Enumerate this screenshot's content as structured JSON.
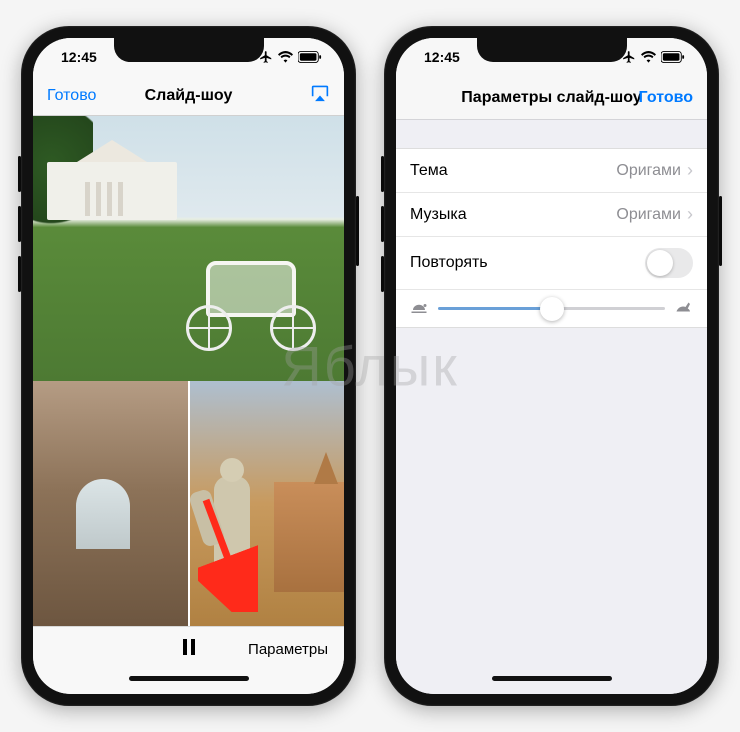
{
  "watermark": "Яблык",
  "status": {
    "time": "12:45"
  },
  "left": {
    "nav": {
      "done": "Готово",
      "title": "Слайд-шоу"
    },
    "toolbar": {
      "options": "Параметры"
    }
  },
  "right": {
    "nav": {
      "title": "Параметры слайд-шоу",
      "done": "Готово"
    },
    "rows": {
      "theme_label": "Тема",
      "theme_value": "Оригами",
      "music_label": "Музыка",
      "music_value": "Оригами",
      "repeat_label": "Повторять"
    }
  }
}
